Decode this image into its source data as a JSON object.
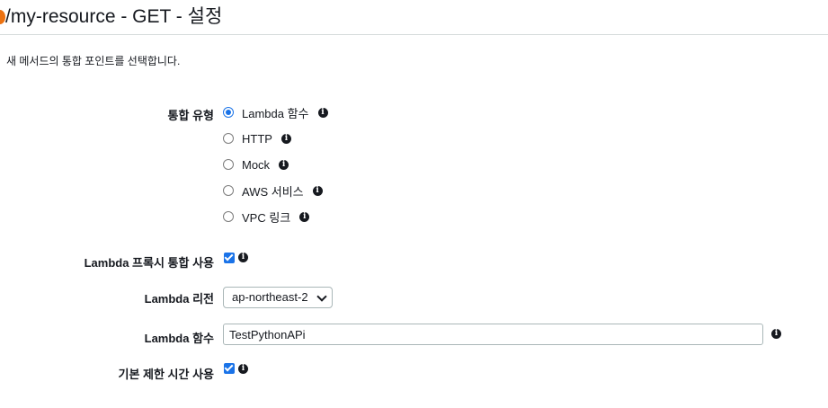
{
  "header": {
    "title": "/my-resource - GET - 설정"
  },
  "description": "새 메서드의 통합 포인트를 선택합니다.",
  "integration_type": {
    "label": "통합 유형",
    "options": [
      {
        "label": "Lambda 함수",
        "selected": true
      },
      {
        "label": "HTTP",
        "selected": false
      },
      {
        "label": "Mock",
        "selected": false
      },
      {
        "label": "AWS 서비스",
        "selected": false
      },
      {
        "label": "VPC 링크",
        "selected": false
      }
    ]
  },
  "lambda_proxy": {
    "label": "Lambda 프록시 통합 사용",
    "checked": true
  },
  "lambda_region": {
    "label": "Lambda 리전",
    "value": "ap-northeast-2"
  },
  "lambda_function": {
    "label": "Lambda 함수",
    "value": "TestPythonAPi"
  },
  "default_timeout": {
    "label": "기본 제한 시간 사용",
    "checked": true
  },
  "info_icon_glyph": "i",
  "colors": {
    "accent": "#1a73e8",
    "header_accent": "#ec7211"
  }
}
